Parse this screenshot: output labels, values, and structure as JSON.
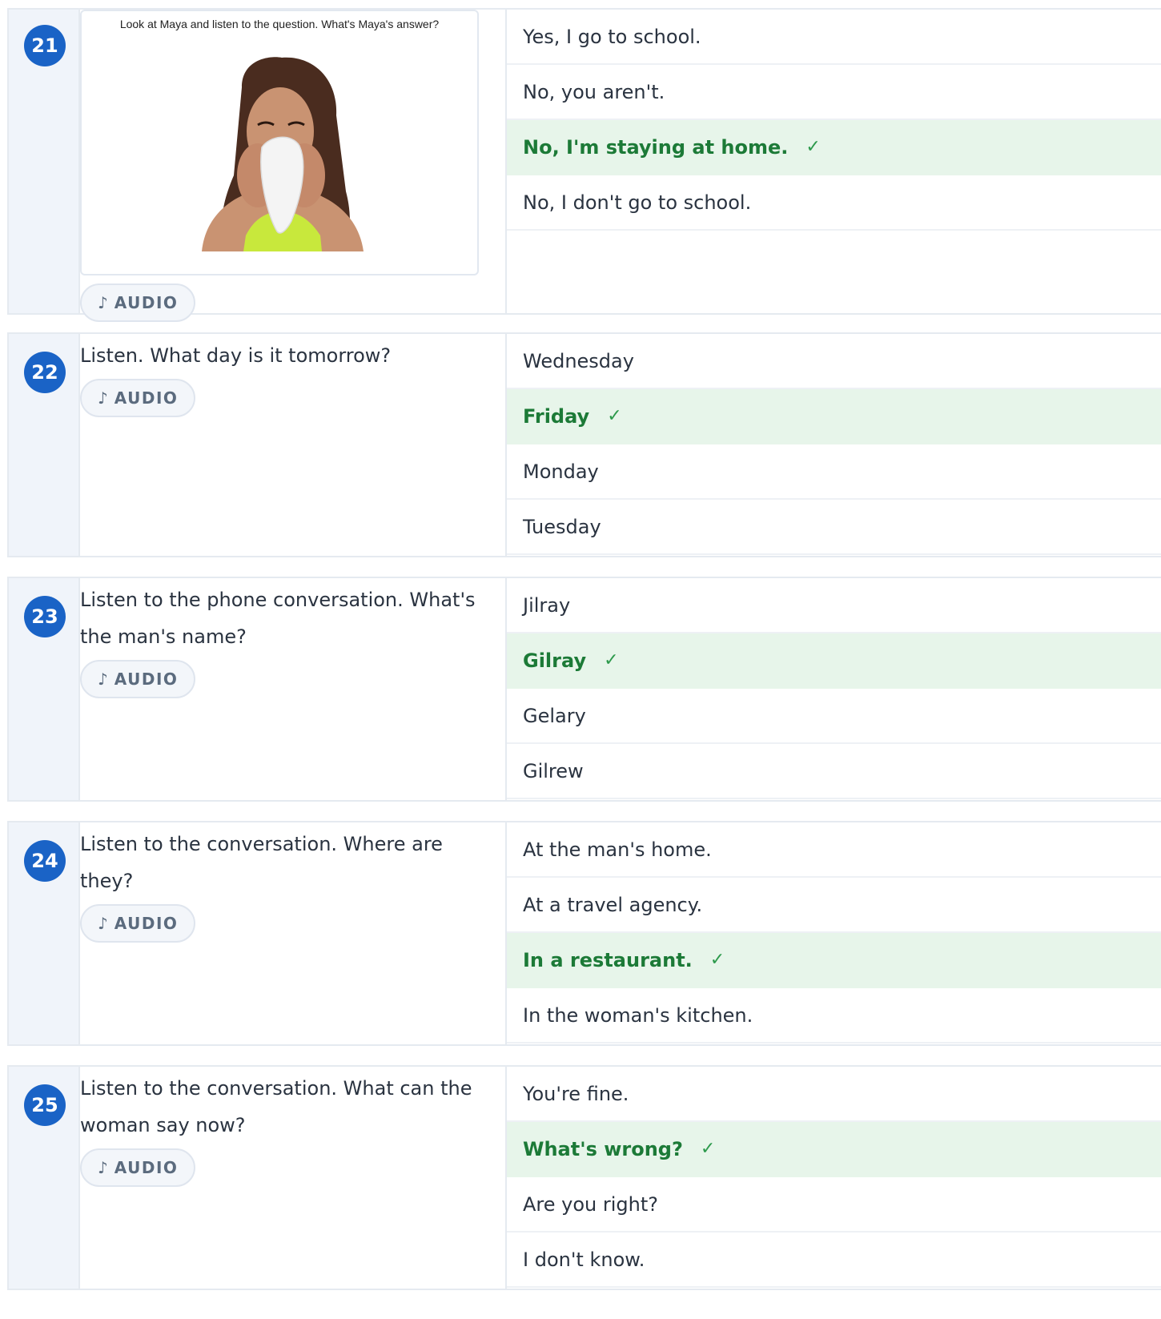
{
  "questions": [
    {
      "number": "21",
      "figure_caption": "Look at Maya and listen to the question. What's Maya's answer?",
      "figure_icon": "woman-sneezing-into-tissue-photo",
      "audio_label": "AUDIO",
      "answers": [
        {
          "text": "Yes, I go to school.",
          "correct": false
        },
        {
          "text": "No, you aren't.",
          "correct": false
        },
        {
          "text": "No, I'm staying at home.",
          "correct": true
        },
        {
          "text": "No, I don't go to school.",
          "correct": false
        }
      ]
    },
    {
      "number": "22",
      "prompt": "Listen. What day is it tomorrow?",
      "audio_label": "AUDIO",
      "answers": [
        {
          "text": "Wednesday",
          "correct": false
        },
        {
          "text": "Friday",
          "correct": true
        },
        {
          "text": "Monday",
          "correct": false
        },
        {
          "text": "Tuesday",
          "correct": false
        }
      ]
    },
    {
      "number": "23",
      "prompt": "Listen to the phone conversation. What's the man's name?",
      "audio_label": "AUDIO",
      "answers": [
        {
          "text": "Jilray",
          "correct": false
        },
        {
          "text": "Gilray",
          "correct": true
        },
        {
          "text": "Gelary",
          "correct": false
        },
        {
          "text": "Gilrew",
          "correct": false
        }
      ]
    },
    {
      "number": "24",
      "prompt": "Listen to the conversation. Where are they?",
      "audio_label": "AUDIO",
      "answers": [
        {
          "text": "At the man's home.",
          "correct": false
        },
        {
          "text": "At a travel agency.",
          "correct": false
        },
        {
          "text": "In a restaurant.",
          "correct": true
        },
        {
          "text": "In the woman's kitchen.",
          "correct": false
        }
      ]
    },
    {
      "number": "25",
      "prompt": "Listen to the conversation. What can the woman say now?",
      "audio_label": "AUDIO",
      "answers": [
        {
          "text": "You're fine.",
          "correct": false
        },
        {
          "text": "What's wrong?",
          "correct": true
        },
        {
          "text": "Are you right?",
          "correct": false
        },
        {
          "text": "I don't know.",
          "correct": false
        }
      ]
    }
  ],
  "symbols": {
    "audio_icon": "♪",
    "check_icon": "✓"
  },
  "colors": {
    "accent": "#1a63c6",
    "correct_text": "#1c7a37",
    "correct_bg": "#e7f5ea"
  }
}
